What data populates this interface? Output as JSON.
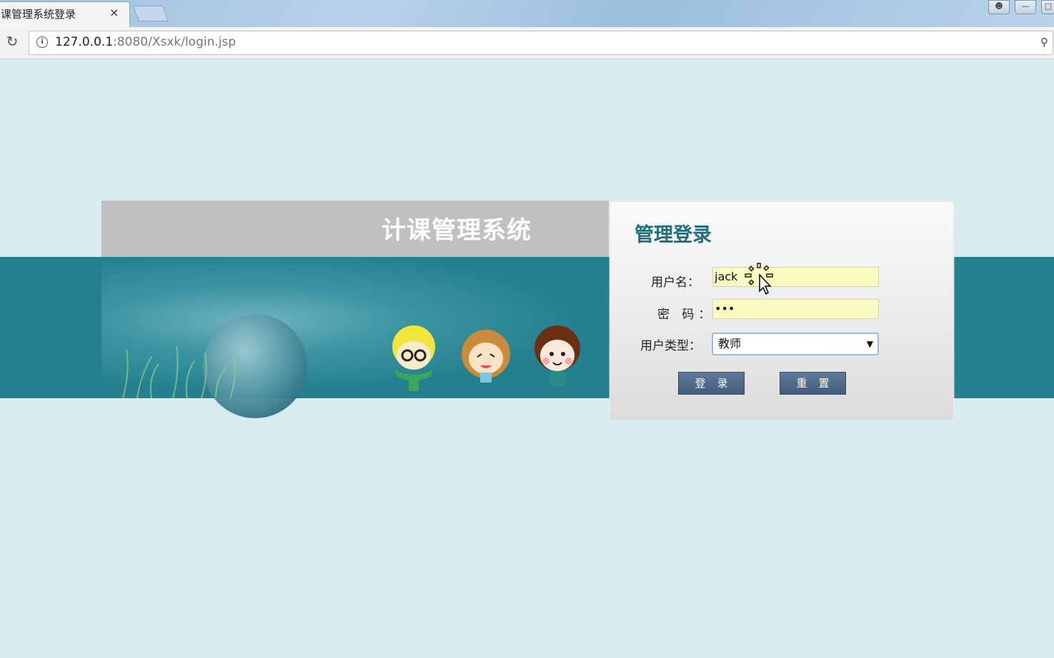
{
  "browser": {
    "tab_title": "课管理系统登录",
    "tab_close": "×",
    "url_host": "127.0.0.1",
    "url_rest": ":8080/Xsxk/login.jsp"
  },
  "page": {
    "system_title": "计课管理系统"
  },
  "login": {
    "title": "管理登录",
    "username_label": "用户名：",
    "username_value": "jack",
    "password_label": "密 码：",
    "password_value": "•••",
    "usertype_label": "用户类型：",
    "usertype_value": "教师",
    "login_button": "登录",
    "reset_button": "重置"
  },
  "colors": {
    "page_bg": "#d8ebef",
    "teal": "#24808e",
    "title_teal": "#1f6d7a",
    "input_yellow": "#fafcc2",
    "button": "#4e6a8a"
  }
}
